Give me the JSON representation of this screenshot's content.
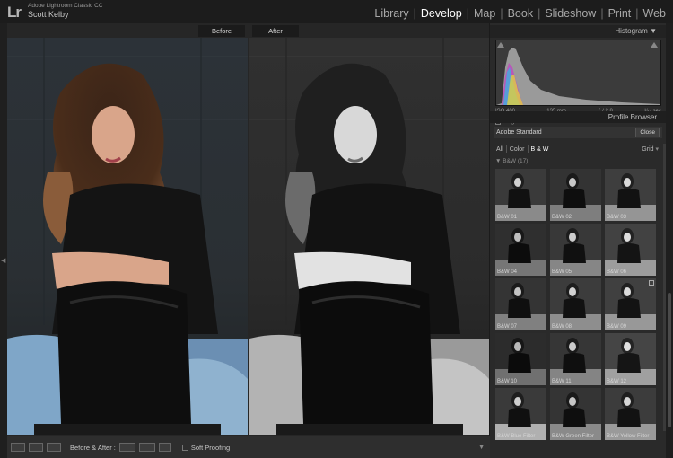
{
  "app": {
    "logo": "Lr",
    "product_name": "Adobe Lightroom Classic CC",
    "user_name": "Scott Kelby"
  },
  "modules": [
    {
      "label": "Library",
      "active": false
    },
    {
      "label": "Develop",
      "active": true
    },
    {
      "label": "Map",
      "active": false
    },
    {
      "label": "Book",
      "active": false
    },
    {
      "label": "Slideshow",
      "active": false
    },
    {
      "label": "Print",
      "active": false
    },
    {
      "label": "Web",
      "active": false
    }
  ],
  "view": {
    "before_label": "Before",
    "after_label": "After"
  },
  "histogram": {
    "title": "Histogram",
    "iso": "ISO 400",
    "focal_length": "135 mm",
    "aperture": "ƒ / 2.8",
    "shutter": "¹⁄₆₄ sec",
    "original_photo_label": "Original Photo"
  },
  "profile_browser": {
    "title": "Profile Browser",
    "current_profile": "Adobe Standard",
    "close_label": "Close",
    "filters": [
      "All",
      "Color",
      "B & W"
    ],
    "active_filter": "B & W",
    "view_mode": "Grid",
    "group_label": "B&W (17)",
    "thumbnails": [
      "B&W 01",
      "B&W 02",
      "B&W 03",
      "B&W 04",
      "B&W 05",
      "B&W 06",
      "B&W 07",
      "B&W 08",
      "B&W 09",
      "B&W 10",
      "B&W 11",
      "B&W 12",
      "B&W Blue Filter",
      "B&W Green Filter",
      "B&W Yellow Filter"
    ]
  },
  "toolbar": {
    "before_after_label": "Before & After :",
    "soft_proofing_label": "Soft Proofing"
  },
  "icons": {
    "panel_collapse": "triangle-down-icon",
    "left_panel_toggle": "triangle-left-icon",
    "group_toggle": "triangle-down-icon"
  }
}
